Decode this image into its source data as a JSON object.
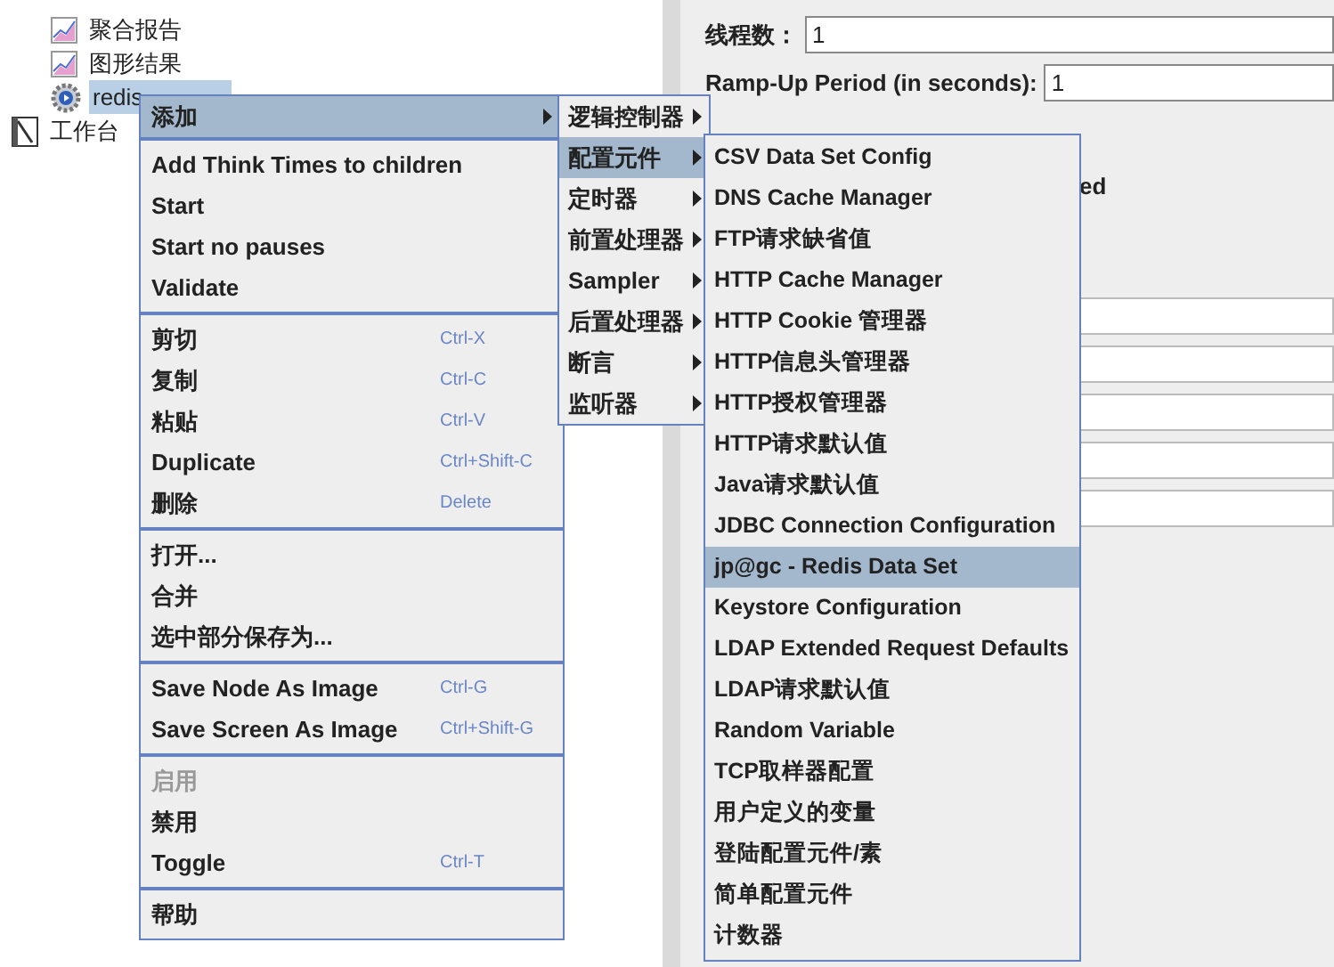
{
  "tree": {
    "items": [
      {
        "label": "聚合报告",
        "kind": "chart",
        "selected": false
      },
      {
        "label": "图形结果",
        "kind": "chart",
        "selected": false
      },
      {
        "label": "redis",
        "kind": "gear",
        "selected": true
      },
      {
        "label": "工作台",
        "kind": "notebook",
        "selected": false
      }
    ]
  },
  "form": {
    "fields": [
      {
        "label": "线程数：",
        "value": "1"
      },
      {
        "label": "Ramp-Up Period (in seconds):",
        "value": "1"
      }
    ],
    "fragment": "ed"
  },
  "context_menu": {
    "groups": [
      [
        {
          "label": "添加",
          "disabled": false,
          "has_submenu": true,
          "selected": true
        }
      ],
      [
        {
          "label": "Add Think Times to children",
          "disabled": false,
          "has_submenu": false,
          "selected": false
        },
        {
          "label": "Start",
          "disabled": false,
          "has_submenu": false,
          "selected": false
        },
        {
          "label": "Start no pauses",
          "disabled": false,
          "has_submenu": false,
          "selected": false
        },
        {
          "label": "Validate",
          "disabled": false,
          "has_submenu": false,
          "selected": false
        }
      ],
      [
        {
          "label": "剪切",
          "shortcut": "Ctrl-X",
          "disabled": false,
          "has_submenu": false,
          "selected": false
        },
        {
          "label": "复制",
          "shortcut": "Ctrl-C",
          "disabled": false,
          "has_submenu": false,
          "selected": false
        },
        {
          "label": "粘贴",
          "shortcut": "Ctrl-V",
          "disabled": false,
          "has_submenu": false,
          "selected": false
        },
        {
          "label": "Duplicate",
          "shortcut": "Ctrl+Shift-C",
          "disabled": false,
          "has_submenu": false,
          "selected": false
        },
        {
          "label": "删除",
          "shortcut": "Delete",
          "disabled": false,
          "has_submenu": false,
          "selected": false
        }
      ],
      [
        {
          "label": "打开...",
          "disabled": false,
          "has_submenu": false,
          "selected": false
        },
        {
          "label": "合并",
          "disabled": false,
          "has_submenu": false,
          "selected": false
        },
        {
          "label": "选中部分保存为...",
          "disabled": false,
          "has_submenu": false,
          "selected": false
        }
      ],
      [
        {
          "label": "Save Node As Image",
          "shortcut": "Ctrl-G",
          "disabled": false,
          "has_submenu": false,
          "selected": false
        },
        {
          "label": "Save Screen As Image",
          "shortcut": "Ctrl+Shift-G",
          "disabled": false,
          "has_submenu": false,
          "selected": false
        }
      ],
      [
        {
          "label": "启用",
          "disabled": true,
          "has_submenu": false,
          "selected": false
        },
        {
          "label": "禁用",
          "disabled": false,
          "has_submenu": false,
          "selected": false
        },
        {
          "label": "Toggle",
          "shortcut": "Ctrl-T",
          "disabled": false,
          "has_submenu": false,
          "selected": false
        }
      ],
      [
        {
          "label": "帮助",
          "disabled": false,
          "has_submenu": false,
          "selected": false
        }
      ]
    ]
  },
  "add_submenu": {
    "items": [
      {
        "label": "逻辑控制器",
        "selected": false
      },
      {
        "label": "配置元件",
        "selected": true
      },
      {
        "label": "定时器",
        "selected": false
      },
      {
        "label": "前置处理器",
        "selected": false
      },
      {
        "label": "Sampler",
        "selected": false
      },
      {
        "label": "后置处理器",
        "selected": false
      },
      {
        "label": "断言",
        "selected": false
      },
      {
        "label": "监听器",
        "selected": false
      }
    ]
  },
  "config_submenu": {
    "items": [
      {
        "label": "CSV Data Set Config",
        "selected": false
      },
      {
        "label": "DNS Cache Manager",
        "selected": false
      },
      {
        "label": "FTP请求缺省值",
        "selected": false
      },
      {
        "label": "HTTP Cache Manager",
        "selected": false
      },
      {
        "label": "HTTP Cookie 管理器",
        "selected": false
      },
      {
        "label": "HTTP信息头管理器",
        "selected": false
      },
      {
        "label": "HTTP授权管理器",
        "selected": false
      },
      {
        "label": "HTTP请求默认值",
        "selected": false
      },
      {
        "label": "Java请求默认值",
        "selected": false
      },
      {
        "label": "JDBC Connection Configuration",
        "selected": false
      },
      {
        "label": "jp@gc - Redis Data Set",
        "selected": true
      },
      {
        "label": "Keystore Configuration",
        "selected": false
      },
      {
        "label": "LDAP Extended Request Defaults",
        "selected": false
      },
      {
        "label": "LDAP请求默认值",
        "selected": false
      },
      {
        "label": "Random Variable",
        "selected": false
      },
      {
        "label": "TCP取样器配置",
        "selected": false
      },
      {
        "label": "用户定义的变量",
        "selected": false
      },
      {
        "label": "登陆配置元件/素",
        "selected": false
      },
      {
        "label": "简单配置元件",
        "selected": false
      },
      {
        "label": "计数器",
        "selected": false
      }
    ]
  }
}
